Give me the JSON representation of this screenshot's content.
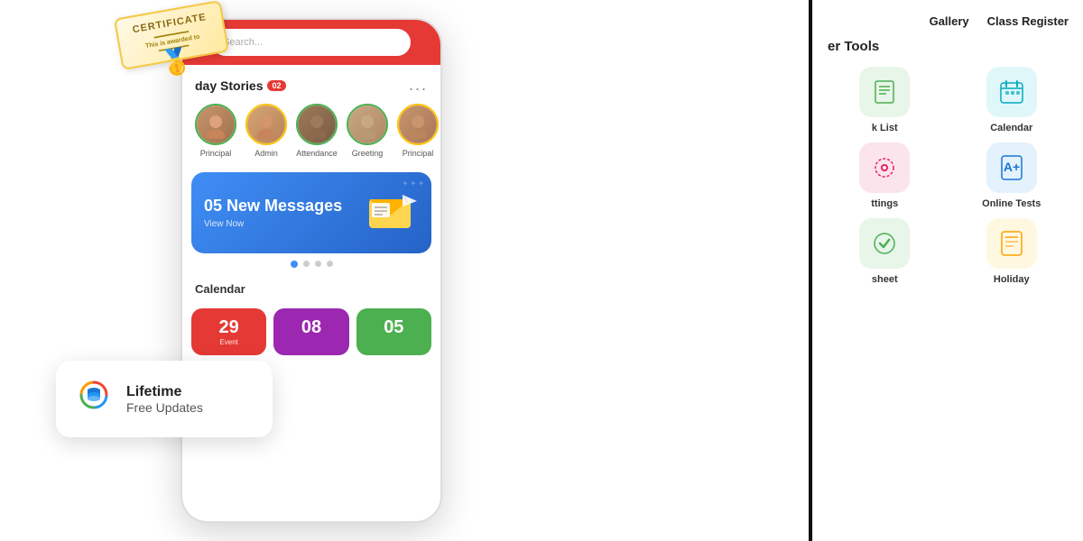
{
  "phone": {
    "search_placeholder": "Search...",
    "stories_title": "day Stories",
    "stories_badge": "02",
    "stories_more": "...",
    "avatars": [
      {
        "label": "Principal",
        "border": "green"
      },
      {
        "label": "Admin",
        "border": "yellow"
      },
      {
        "label": "Attendance",
        "border": "green"
      },
      {
        "label": "Greeting",
        "border": "green"
      },
      {
        "label": "Principal",
        "border": "yellow"
      }
    ],
    "banner_title": "05 New Messages",
    "calendar_label": "Calendar",
    "cal_cards": [
      {
        "number": "29",
        "label": "Event",
        "color": "red"
      },
      {
        "number": "08",
        "color": "purple"
      },
      {
        "number": "05",
        "color": "green"
      }
    ]
  },
  "lifetime": {
    "bold": "Lifetime",
    "light": "Free Updates"
  },
  "certificate": {
    "text": "CERTIFICATE"
  },
  "right_panel": {
    "top_links": [
      "Gallery",
      "Class Register"
    ],
    "section_title": "er Tools",
    "tools": [
      {
        "label": "k List",
        "icon": "📋",
        "color": "green"
      },
      {
        "label": "Calendar",
        "icon": "📅",
        "color": "teal"
      },
      {
        "label": "ttings",
        "icon": "⚙️",
        "color": "pink"
      },
      {
        "label": "Online Tests",
        "icon": "📝",
        "color": "blue"
      },
      {
        "label": "sheet",
        "icon": "🔔",
        "color": "green"
      },
      {
        "label": "Holiday",
        "icon": "📖",
        "color": "amber"
      }
    ]
  }
}
